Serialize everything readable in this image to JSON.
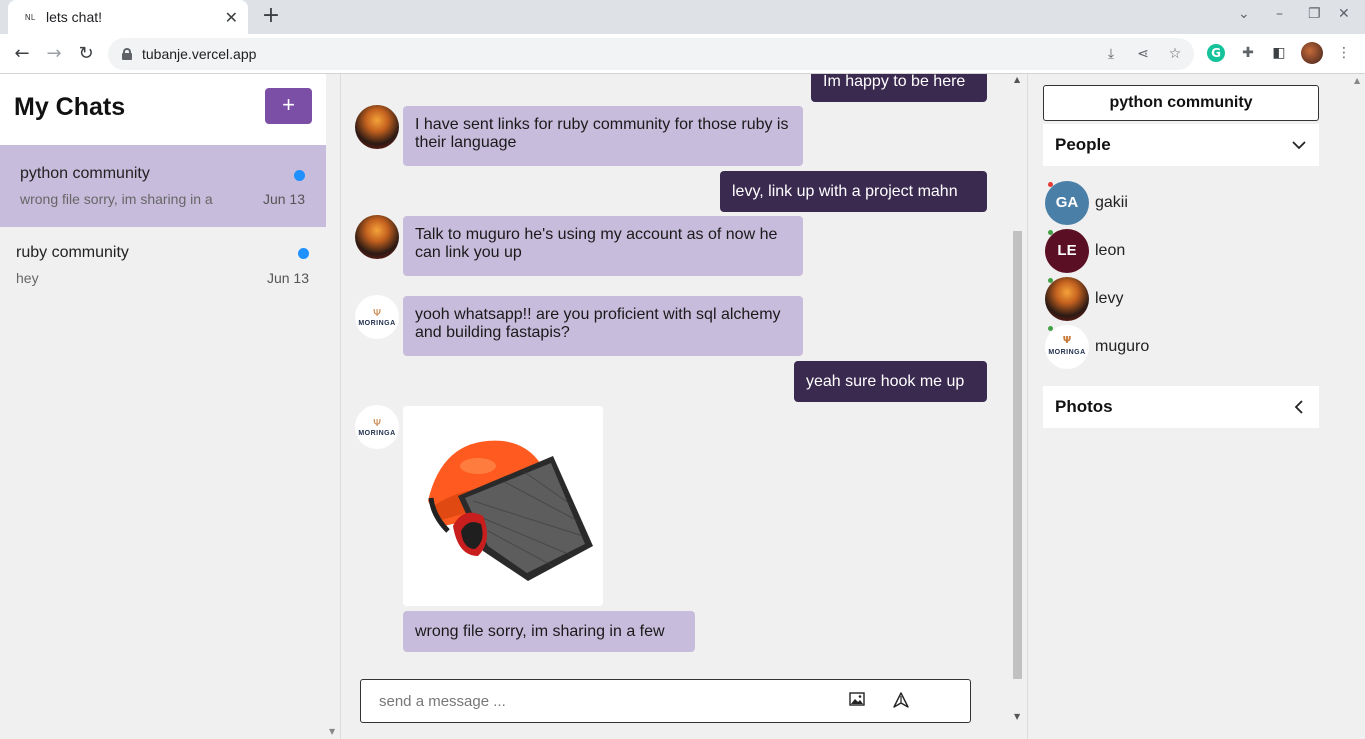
{
  "browser": {
    "tab_title": "lets chat!",
    "favicon_text": "NL",
    "url": "tubanje.vercel.app"
  },
  "sidebar": {
    "title": "My Chats",
    "add_label": "+",
    "chats": [
      {
        "name": "python community",
        "preview": "wrong file sorry, im sharing in a",
        "date": "Jun 13",
        "unread": true,
        "active": true
      },
      {
        "name": "ruby community",
        "preview": "hey",
        "date": "Jun 13",
        "unread": true,
        "active": false
      }
    ]
  },
  "messages": [
    {
      "text": "Im happy to be here",
      "direction": "out"
    },
    {
      "text": "I have sent links for ruby community for those ruby is their language",
      "direction": "in",
      "sender": "levy"
    },
    {
      "text": "levy, link up with a project mahn",
      "direction": "out"
    },
    {
      "text": "Talk to muguro he's using my account as of now he can link you up",
      "direction": "in",
      "sender": "levy"
    },
    {
      "text": "yooh whatsapp!! are you proficient with sql alchemy and building fastapis?",
      "direction": "in",
      "sender": "muguro"
    },
    {
      "text": "yeah sure hook me up",
      "direction": "out"
    },
    {
      "image": "safety-helmet-with-visor",
      "direction": "in",
      "sender": "muguro"
    },
    {
      "text": "wrong file sorry, im sharing in a few",
      "direction": "in",
      "sender": "muguro"
    }
  ],
  "composer": {
    "placeholder": "send a message ...",
    "image_icon": "image-icon",
    "send_icon": "send-icon"
  },
  "details": {
    "room_name": "python community",
    "people_label": "People",
    "photos_label": "Photos",
    "people": [
      {
        "name": "gakii",
        "initials": "GA",
        "color": "#4a7fa8",
        "status_color": "#e53935"
      },
      {
        "name": "leon",
        "initials": "LE",
        "color": "#5a0f24",
        "status_color": "#43a047"
      },
      {
        "name": "levy",
        "initials": "",
        "color": "#8a1d12",
        "status_color": "#43a047"
      },
      {
        "name": "muguro",
        "initials": "",
        "color": "#ffffff",
        "status_color": "#43a047"
      }
    ]
  },
  "moringa": {
    "brand": "MORINGA"
  },
  "colors": {
    "accent": "#7b4fa6",
    "incoming_bubble": "#c8bcdc",
    "outgoing_bubble": "#3b2a50",
    "unread": "#1e90ff"
  }
}
